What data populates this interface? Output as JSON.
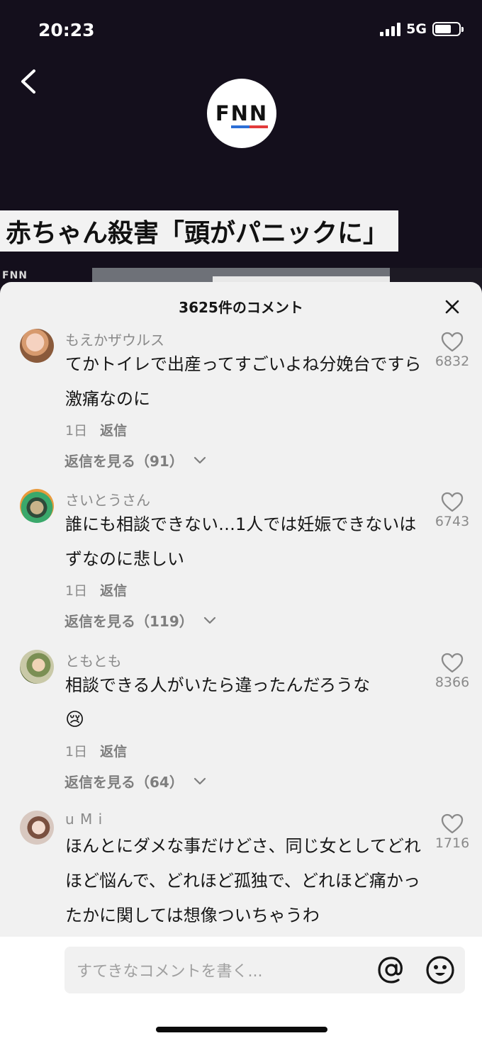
{
  "status_bar": {
    "time": "20:23",
    "network": "5G"
  },
  "video": {
    "logo_text": "FNN",
    "headline": "赤ちゃん殺害「頭がパニックに」",
    "corner_logo": "FNN"
  },
  "comments_panel": {
    "title": "3625件のコメント",
    "comments": [
      {
        "username": "もえかザウルス",
        "text": "てかトイレで出産ってすごいよね分娩台ですら激痛なのに",
        "time": "1日",
        "reply_label": "返信",
        "view_replies": "返信を見る（91）",
        "likes": "6832"
      },
      {
        "username": "さいとうさん",
        "text": "誰にも相談できない…1人では妊娠できないはずなのに悲しい",
        "time": "1日",
        "reply_label": "返信",
        "view_replies": "返信を見る（119）",
        "likes": "6743"
      },
      {
        "username": "ともとも",
        "text": "相談できる人がいたら違ったんだろうな",
        "emoji": "😢",
        "time": "1日",
        "reply_label": "返信",
        "view_replies": "返信を見る（64）",
        "likes": "8366"
      },
      {
        "username": "u M i",
        "text": "ほんとにダメな事だけどさ、同じ女としてどれほど悩んで、どれほど孤独で、どれほど痛かったかに関しては想像ついちゃうわ",
        "likes": "1716"
      }
    ]
  },
  "comment_input": {
    "placeholder": "すてきなコメントを書く..."
  },
  "colors": {
    "sheet_bg": "#f1f1f1",
    "video_bg": "#140f1c",
    "muted_text": "#8a8a8a"
  }
}
